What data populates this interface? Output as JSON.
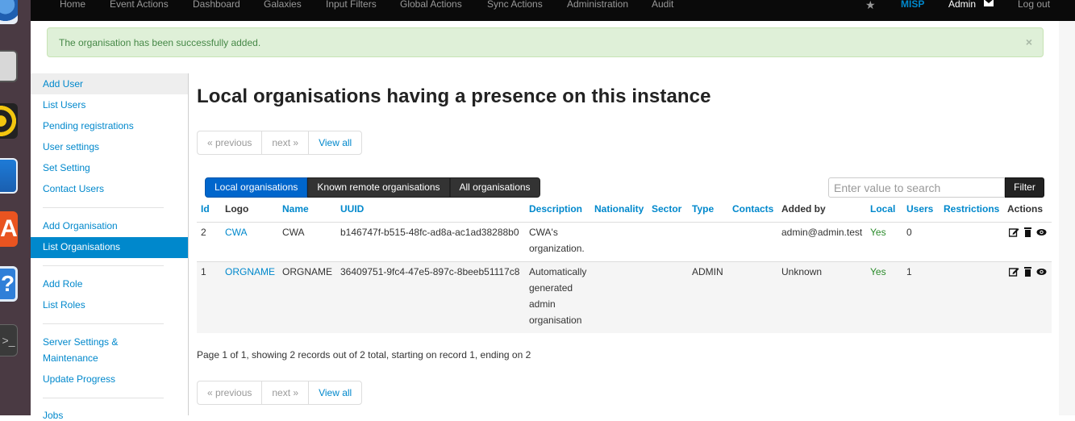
{
  "dock": {
    "apps": [
      "browser-icon",
      "files-icon",
      "music-player-icon",
      "writer-icon",
      "software-store-icon",
      "help-icon",
      "terminal-icon"
    ],
    "help_glyph": "?",
    "store_glyph": "A",
    "terminal_glyph": ">_"
  },
  "navbar": {
    "items": [
      "Home",
      "Event Actions",
      "Dashboard",
      "Galaxies",
      "Input Filters",
      "Global Actions",
      "Sync Actions",
      "Administration",
      "Audit"
    ],
    "brand": "MISP",
    "user": "Admin",
    "logout": "Log out",
    "colors": {
      "background": "#0a0a0a",
      "brand": "#0088cc"
    }
  },
  "alert": {
    "message": "The organisation has been successfully added.",
    "close": "×"
  },
  "sidebar": {
    "items": [
      "Add User",
      "List Users",
      "Pending registrations",
      "User settings",
      "Set Setting",
      "Contact Users",
      "Add Organisation",
      "List Organisations",
      "Add Role",
      "List Roles",
      "Server Settings &",
      "Maintenance",
      "Update Progress",
      "Jobs"
    ],
    "selected": "List Organisations"
  },
  "main": {
    "title": "Local organisations having a presence on this instance",
    "pager": {
      "previous": "« previous",
      "next": "next »",
      "view_all": "View all"
    },
    "tabs": [
      "Local organisations",
      "Known remote organisations",
      "All organisations"
    ],
    "search": {
      "placeholder": "Enter value to search",
      "value": ""
    },
    "filter_label": "Filter",
    "table": {
      "headers": [
        "Id",
        "Logo",
        "Name",
        "UUID",
        "Description",
        "Nationality",
        "Sector",
        "Type",
        "Contacts",
        "Added by",
        "Local",
        "Users",
        "Restrictions",
        "Actions"
      ],
      "rows": [
        {
          "id": "2",
          "logo": "CWA",
          "name": "CWA",
          "uuid": "b146747f-b515-48fc-ad8a-ac1ad38288b0",
          "description": [
            "CWA's",
            "organization."
          ],
          "nationality": "",
          "sector": "",
          "type": "",
          "contacts": "",
          "added_by": "admin@admin.test",
          "local": "Yes",
          "users": "0",
          "restrictions": ""
        },
        {
          "id": "1",
          "logo": "ORGNAME",
          "name": "ORGNAME",
          "uuid": "36409751-9fc4-47e5-897c-8beeb51117c8",
          "description": [
            "Automatically",
            "generated",
            "admin",
            "organisation"
          ],
          "nationality": "",
          "sector": "",
          "type": "ADMIN",
          "contacts": "",
          "added_by": "Unknown",
          "local": "Yes",
          "users": "1",
          "restrictions": ""
        }
      ],
      "action_icons": [
        "edit-icon",
        "delete-icon",
        "view-icon"
      ]
    },
    "pagination_info": "Page 1 of 1, showing 2 records out of 2 total, starting on record 1, ending on 2"
  }
}
